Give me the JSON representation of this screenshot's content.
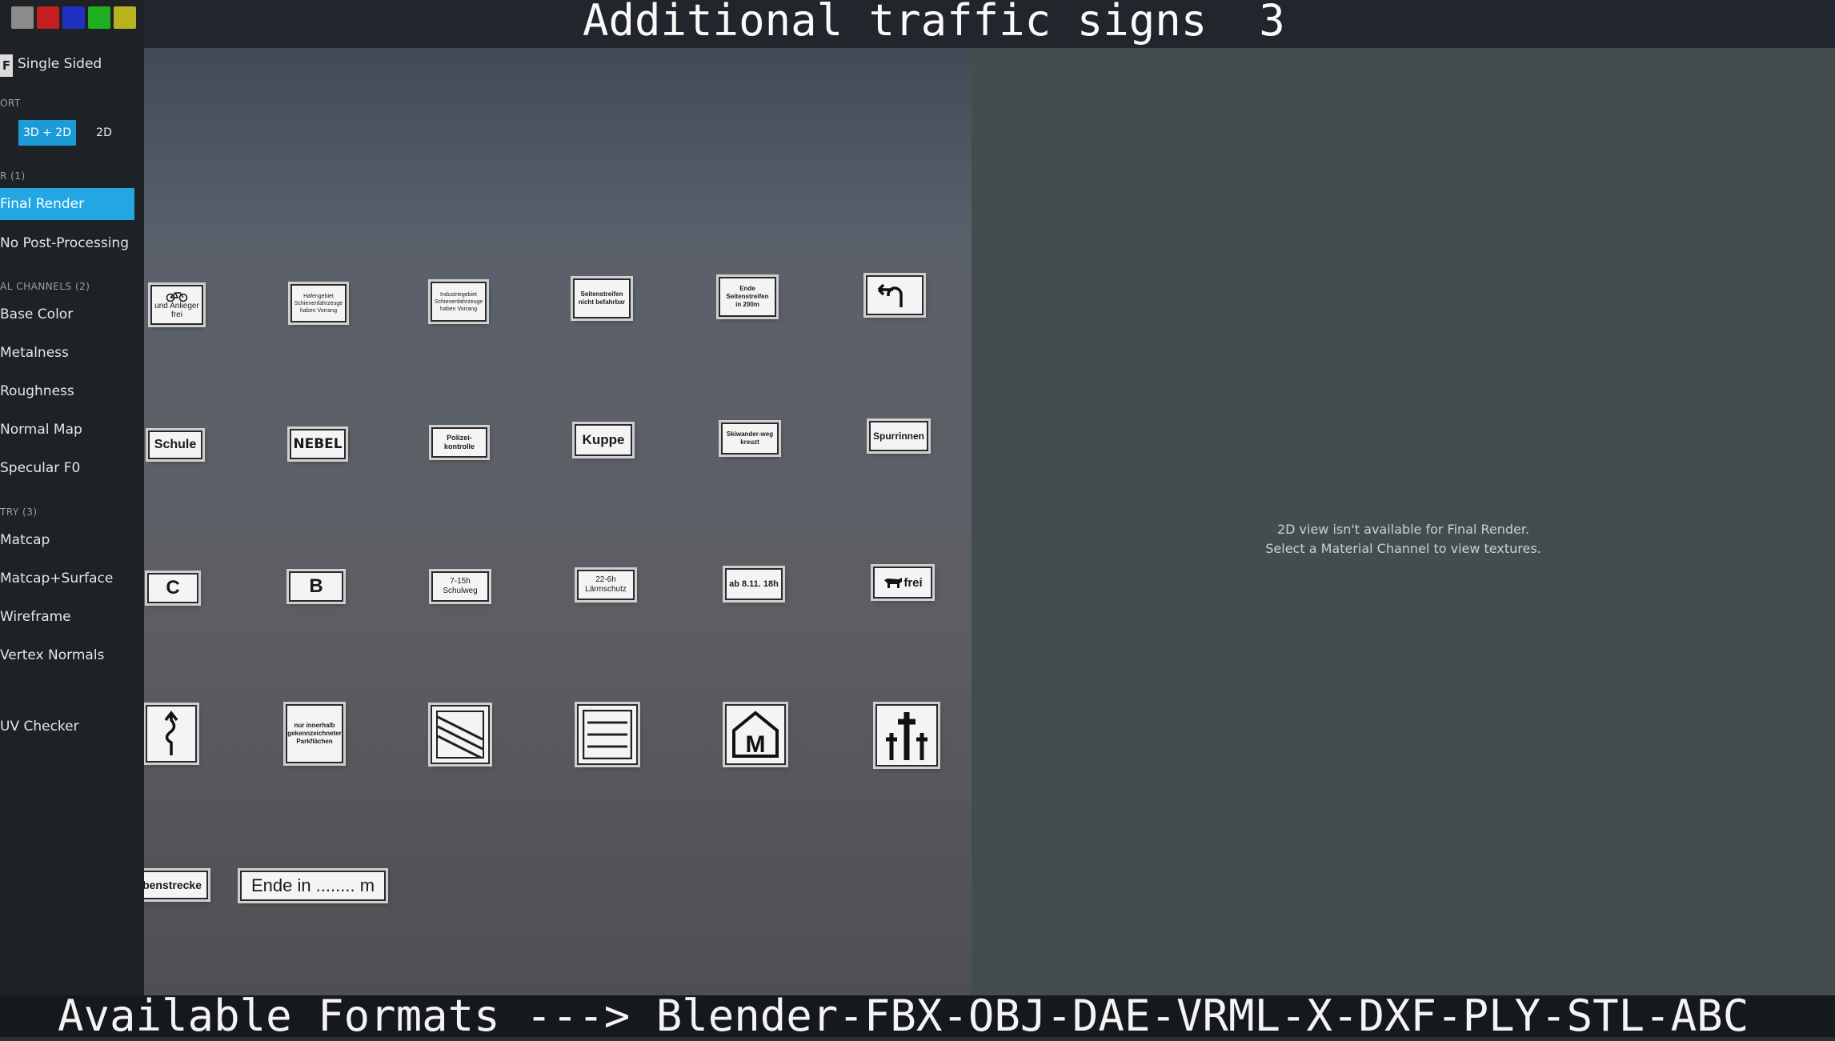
{
  "title": "Additional traffic signs  3",
  "footer": "Available Formats ---> Blender-FBX-OBJ-DAE-VRML-X-DXF-PLY-STL-ABC",
  "colors": {
    "swatches": [
      "#8b8b8b",
      "#c41e1e",
      "#1f2fbf",
      "#1fae1f",
      "#b8b21f"
    ],
    "accent": "#22a6e4"
  },
  "sidebar": {
    "single_sided_badge": "F",
    "single_sided": "Single Sided",
    "viewport_section": "ORT",
    "btn_3d2d": "3D + 2D",
    "btn_2d": "2D",
    "render_section": "R (1)",
    "final_render": "Final Render",
    "no_post": "No Post-Processing",
    "channels_section": "AL CHANNELS (2)",
    "base_color": "Base Color",
    "metalness": "Metalness",
    "roughness": "Roughness",
    "normal_map": "Normal Map",
    "specular": "Specular F0",
    "geometry_section": "TRY (3)",
    "matcap": "Matcap",
    "matcap_surface": "Matcap+Surface",
    "wireframe": "Wireframe",
    "vertex_normals": "Vertex Normals",
    "uv_checker": "UV Checker"
  },
  "viewport_2d": {
    "line1": "2D view isn't available for Final Render.",
    "line2": "Select a Material Channel to view textures."
  },
  "signs": {
    "r1": [
      "und Anlieger frei",
      "Hafengebiet Schienenfahrzeuge haben Vorrang",
      "Industriegebiet Schienenfahrzeuge haben Vorrang",
      "Seitenstreifen nicht befahrbar",
      "Ende Seitenstreifen in 200m",
      ""
    ],
    "r2": [
      "Schule",
      "NEBEL",
      "Polizei-kontrolle",
      "Kuppe",
      "Skiwander-weg kreuzt",
      "Spurrinnen"
    ],
    "r3": [
      "C",
      "B",
      "7-15h Schulweg",
      "22-6h Lärmschutz",
      "ab 8.11. 18h",
      "frei"
    ],
    "r4": [
      "",
      "nur innerhalb gekennzeichneter Parkflächen",
      "",
      "",
      "M",
      ""
    ],
    "r5": [
      "benstrecke",
      "Ende in ........ m"
    ]
  }
}
